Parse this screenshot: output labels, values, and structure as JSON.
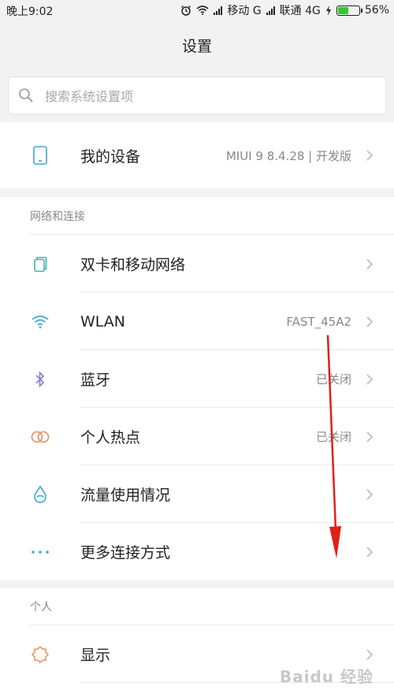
{
  "status_bar": {
    "time": "晚上9:02",
    "carrier1": "移动 G",
    "carrier2": "联通 4G",
    "battery": "56%",
    "battery_level": 0.56
  },
  "header": {
    "title": "设置"
  },
  "search": {
    "placeholder": "搜索系统设置项"
  },
  "my_device": {
    "label": "我的设备",
    "value": "MIUI 9 8.4.28 | 开发版"
  },
  "sections": [
    {
      "title": "网络和连接",
      "items": [
        {
          "label": "双卡和移动网络",
          "value": "",
          "icon": "dual-sim-icon"
        },
        {
          "label": "WLAN",
          "value": "FAST_45A2",
          "icon": "wifi-icon"
        },
        {
          "label": "蓝牙",
          "value": "已关闭",
          "icon": "bluetooth-icon"
        },
        {
          "label": "个人热点",
          "value": "已关闭",
          "icon": "hotspot-icon"
        },
        {
          "label": "流量使用情况",
          "value": "",
          "icon": "data-usage-icon"
        },
        {
          "label": "更多连接方式",
          "value": "",
          "icon": "more-dots-icon"
        }
      ]
    },
    {
      "title": "个人",
      "items": [
        {
          "label": "显示",
          "value": "",
          "icon": "brightness-icon"
        }
      ]
    }
  ],
  "watermark": "Baidu 经验",
  "colors": {
    "accent_green": "#31c82f",
    "annotation_red": "#e0201a"
  }
}
